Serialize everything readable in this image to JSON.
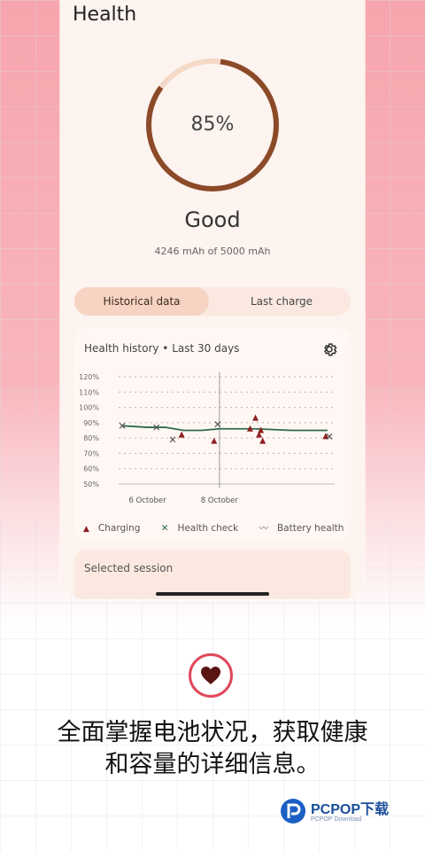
{
  "header": {
    "title": "Health"
  },
  "gauge": {
    "percent_label": "85%",
    "value": 0.85,
    "ring_color": "#8b4a28",
    "track_color": "#f5d9c7"
  },
  "status": {
    "label": "Good",
    "capacity": "4246 mAh of 5000 mAh"
  },
  "tabs": [
    {
      "label": "Historical data",
      "active": true
    },
    {
      "label": "Last charge",
      "active": false
    }
  ],
  "history": {
    "title": "Health history • Last 30 days",
    "settings_icon": "gear-icon"
  },
  "chart_data": {
    "type": "scatter",
    "y_tick_labels": [
      "120%",
      "110%",
      "100%",
      "90%",
      "80%",
      "70%",
      "60%",
      "50%"
    ],
    "ylim": [
      50,
      120
    ],
    "x_tick_labels": [
      "6 October",
      "8 October"
    ],
    "xlim": [
      5.2,
      11.2
    ],
    "series": [
      {
        "name": "Charging",
        "marker": "triangle",
        "color": "#8e1f1f",
        "points": [
          [
            6.95,
            82
          ],
          [
            7.85,
            78
          ],
          [
            8.85,
            86
          ],
          [
            9.0,
            93
          ],
          [
            9.1,
            82
          ],
          [
            9.15,
            85
          ],
          [
            9.2,
            78
          ],
          [
            10.95,
            81
          ]
        ]
      },
      {
        "name": "Health check",
        "marker": "x",
        "color": "#2e6b4a",
        "points": [
          [
            5.3,
            88
          ],
          [
            6.25,
            87
          ],
          [
            6.7,
            79
          ],
          [
            7.95,
            89
          ],
          [
            11.05,
            81
          ]
        ]
      },
      {
        "name": "Battery health",
        "marker": "line",
        "color": "#2e6b4a",
        "points": [
          [
            5.3,
            88
          ],
          [
            6.0,
            87
          ],
          [
            6.5,
            87
          ],
          [
            7.0,
            85
          ],
          [
            7.5,
            85
          ],
          [
            8.0,
            86
          ],
          [
            9.0,
            86
          ],
          [
            10.0,
            85
          ],
          [
            11.0,
            85
          ]
        ]
      }
    ],
    "grid": true
  },
  "legend": {
    "charging": "Charging",
    "health_check": "Health check",
    "battery_health": "Battery health"
  },
  "session": {
    "label": "Selected session"
  },
  "promo": {
    "icon": "heart-icon",
    "line1": "全面掌握电池状况，获取健康",
    "line2": "和容量的详细信息。"
  },
  "watermark": {
    "brand": "PCPOP下载",
    "sub": "PCPOP Download"
  }
}
